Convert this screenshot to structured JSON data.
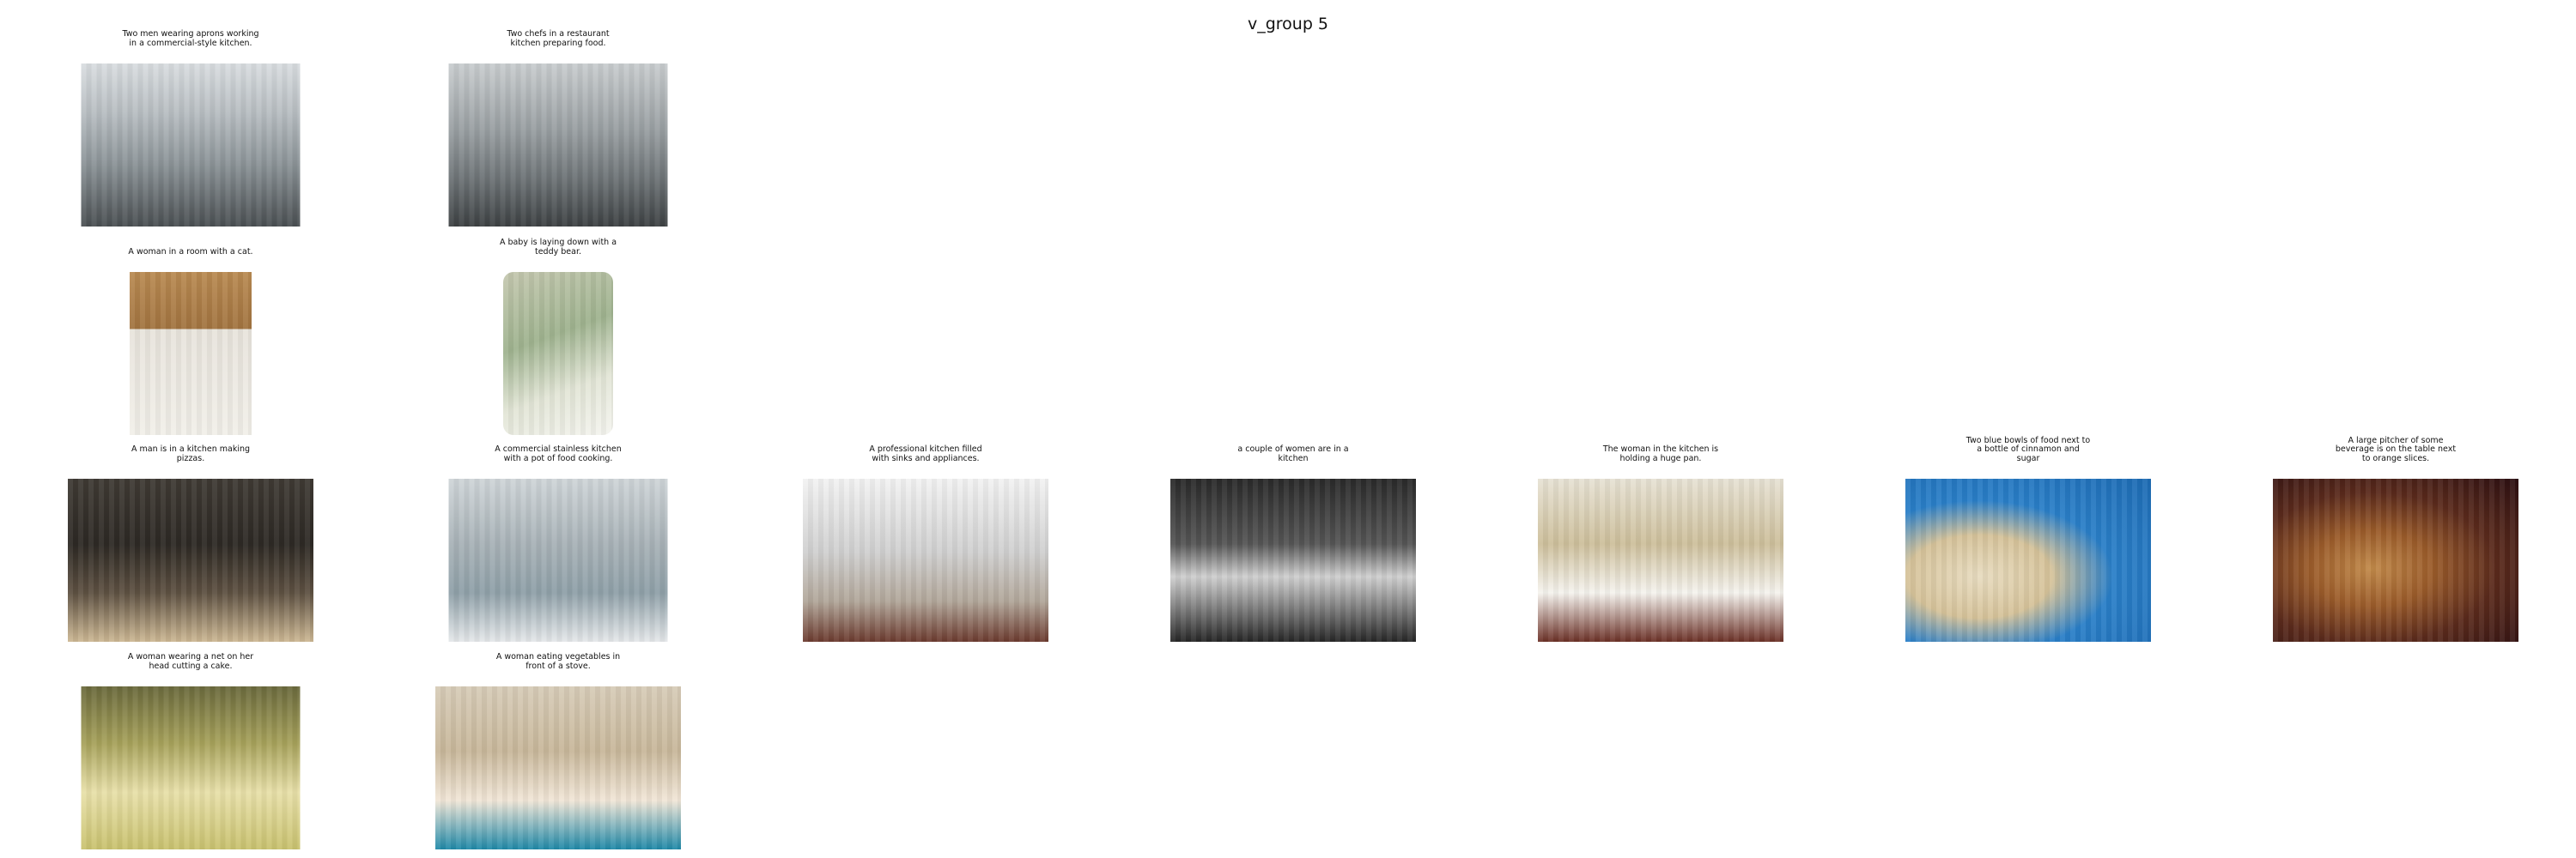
{
  "title": "v_group 5",
  "items": [
    {
      "caption": "Two men wearing aprons working\nin a commercial-style kitchen."
    },
    {
      "caption": "Two chefs in a restaurant\nkitchen preparing food."
    },
    {
      "caption": "A woman in a room with a cat."
    },
    {
      "caption": "A baby is laying down with a\nteddy bear."
    },
    {
      "caption": "A man is in a kitchen making\npizzas."
    },
    {
      "caption": "A commercial stainless kitchen\nwith a pot of food cooking."
    },
    {
      "caption": "A professional kitchen filled\nwith sinks and appliances."
    },
    {
      "caption": "a couple of women  are in a\nkitchen"
    },
    {
      "caption": "The woman in the kitchen is\nholding a huge pan."
    },
    {
      "caption": "Two blue bowls of food next to\na bottle of cinnamon and\nsugar"
    },
    {
      "caption": "A large pitcher of some\nbeverage is on the table next\nto orange slices."
    },
    {
      "caption": "A woman wearing a net on her\nhead cutting a cake."
    },
    {
      "caption": "A woman eating vegetables in\nfront of a stove."
    }
  ]
}
